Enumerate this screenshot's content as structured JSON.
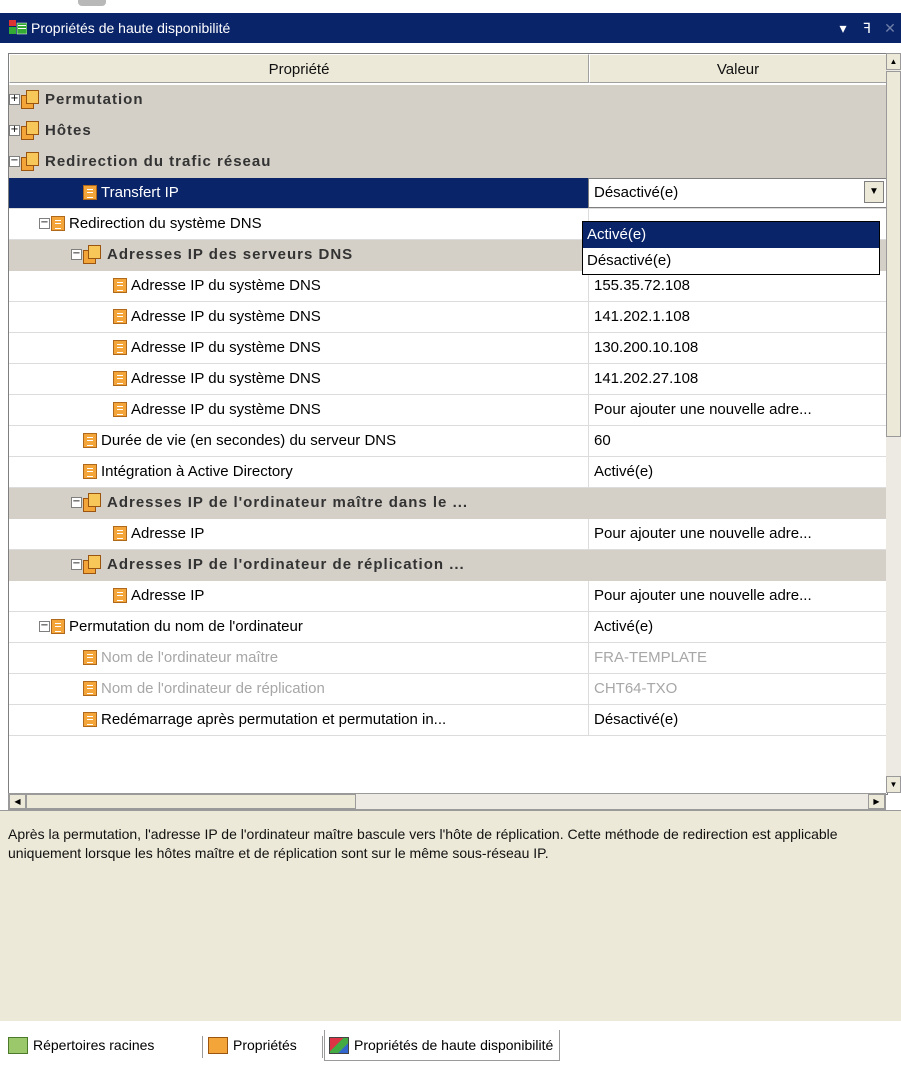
{
  "window": {
    "title": "Propriétés de haute disponibilité",
    "title_icon": "ha-properties-icon",
    "buttons": {
      "dropdown": "▾",
      "pin": "ꟻ",
      "close": "✕"
    }
  },
  "grid": {
    "columns": [
      "Propriété",
      "Valeur"
    ],
    "rows": [
      {
        "type": "category",
        "name": "Permutation",
        "value": "",
        "expander": "+"
      },
      {
        "type": "category",
        "name": "Hôtes",
        "value": "",
        "expander": "+"
      },
      {
        "type": "category",
        "name": "Redirection du trafic réseau",
        "value": "",
        "expander": "−"
      },
      {
        "type": "property",
        "name": "Transfert IP",
        "value": "Désactivé(e)",
        "selected": true
      },
      {
        "type": "property",
        "name": "Redirection du système DNS",
        "value": "",
        "expander": "−"
      },
      {
        "type": "category",
        "name": "Adresses IP des serveurs DNS",
        "value": "",
        "expander": "−"
      },
      {
        "type": "property",
        "name": "Adresse IP du système DNS",
        "value": "155.35.72.108"
      },
      {
        "type": "property",
        "name": "Adresse IP du système DNS",
        "value": "141.202.1.108"
      },
      {
        "type": "property",
        "name": "Adresse IP du système DNS",
        "value": "130.200.10.108"
      },
      {
        "type": "property",
        "name": "Adresse IP du système DNS",
        "value": "141.202.27.108"
      },
      {
        "type": "property",
        "name": "Adresse IP du système DNS",
        "value": "Pour ajouter une nouvelle adre..."
      },
      {
        "type": "property",
        "name": "Durée de vie (en secondes) du serveur DNS",
        "value": "60"
      },
      {
        "type": "property",
        "name": "Intégration à Active Directory",
        "value": "Activé(e)"
      },
      {
        "type": "category",
        "name": "Adresses IP de l'ordinateur maître dans le ...",
        "value": "",
        "expander": "−"
      },
      {
        "type": "property",
        "name": "Adresse IP",
        "value": "Pour ajouter une nouvelle adre..."
      },
      {
        "type": "category",
        "name": "Adresses IP de l'ordinateur de réplication ...",
        "value": "",
        "expander": "−"
      },
      {
        "type": "property",
        "name": "Adresse IP",
        "value": "Pour ajouter une nouvelle adre..."
      },
      {
        "type": "property",
        "name": "Permutation du nom de l'ordinateur",
        "value": "Activé(e)",
        "expander": "−"
      },
      {
        "type": "property",
        "name": "Nom de l'ordinateur maître",
        "value": "FRA-TEMPLATE",
        "disabled": true
      },
      {
        "type": "property",
        "name": "Nom de l'ordinateur de réplication",
        "value": "CHT64-TXO",
        "disabled": true
      },
      {
        "type": "property",
        "name": "Redémarrage après permutation et permutation in...",
        "value": "Désactivé(e)"
      }
    ]
  },
  "dropdown": {
    "current": "Désactivé(e)",
    "options": [
      "Activé(e)",
      "Désactivé(e)"
    ],
    "highlighted": "Activé(e)"
  },
  "description": "Après la permutation, l'adresse IP de l'ordinateur maître bascule vers l'hôte de réplication. Cette méthode de redirection est applicable uniquement lorsque les hôtes maître et de réplication sont sur le même sous-réseau IP.",
  "tabs": [
    {
      "label": "Répertoires racines",
      "icon": "folder-icon",
      "active": false
    },
    {
      "label": "Propriétés",
      "icon": "properties-icon",
      "active": false
    },
    {
      "label": "Propriétés de haute disponibilité",
      "icon": "ha-properties-icon",
      "active": true
    }
  ]
}
